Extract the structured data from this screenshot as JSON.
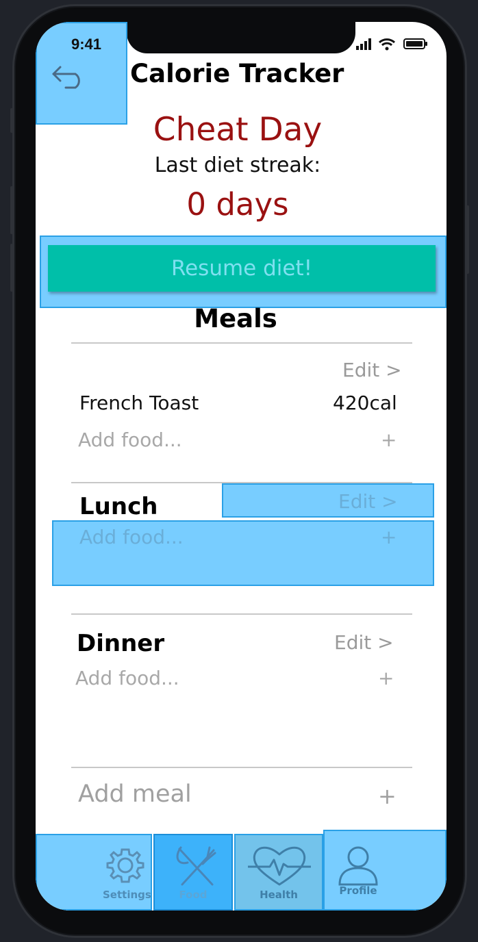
{
  "status_bar": {
    "time": "9:41"
  },
  "header": {
    "title": "Calorie Tracker"
  },
  "status": {
    "day_label": "Cheat Day",
    "streak_label": "Last diet streak:",
    "streak_value": "0 days"
  },
  "resume_button": {
    "label": "Resume diet!"
  },
  "meals": {
    "title": "Meals",
    "breakfast": {
      "edit_label": "Edit >",
      "items": [
        {
          "name": "French Toast",
          "calories": "420cal"
        }
      ],
      "add_food_label": "Add food...",
      "add_symbol": "+"
    },
    "lunch": {
      "name": "Lunch",
      "edit_label": "Edit >",
      "add_food_label": "Add food...",
      "add_symbol": "+"
    },
    "dinner": {
      "name": "Dinner",
      "edit_label": "Edit >",
      "add_food_label": "Add food...",
      "add_symbol": "+"
    },
    "add_meal_label": "Add meal",
    "add_meal_symbol": "+"
  },
  "tabbar": {
    "tabs": [
      {
        "label": "Settings",
        "icon": "gear-icon"
      },
      {
        "label": "Food",
        "icon": "fork-knife-icon"
      },
      {
        "label": "Health",
        "icon": "heart-pulse-icon"
      },
      {
        "label": "Profile",
        "icon": "person-icon"
      }
    ]
  },
  "colors": {
    "accent_red": "#9a1111",
    "resume_button": "#00bfa9",
    "highlight": "#38b6ff"
  }
}
